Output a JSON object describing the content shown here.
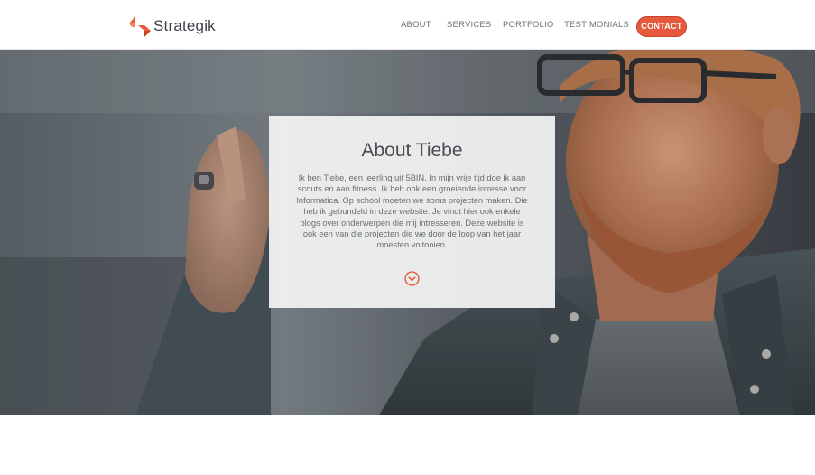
{
  "brand": {
    "name": "Strategik",
    "accent_color": "#e55a3c"
  },
  "nav": {
    "items": [
      {
        "label": "ABOUT"
      },
      {
        "label": "SERVICES"
      },
      {
        "label": "PORTFOLIO"
      },
      {
        "label": "TESTIMONIALS"
      }
    ],
    "contact_label": "CONTACT"
  },
  "hero": {
    "background": "man-with-glasses-photo",
    "card": {
      "title": "About Tiebe",
      "text": "Ik ben Tiebe, een leerling uit 5BIN. In mijn vrije tijd doe ik aan scouts en aan fitness. Ik heb ook een groeiende intresse voor Informatica. Op school moeten we soms projecten maken. Die heb ik gebundeld in deze website. Je vindt hier ook enkele blogs over onderwerpen die mij intresseren. Deze website is ook een van die projecten die we door de loop van het jaar moesten voltooien.",
      "scroll_icon": "chevron-down-circle-icon"
    }
  }
}
